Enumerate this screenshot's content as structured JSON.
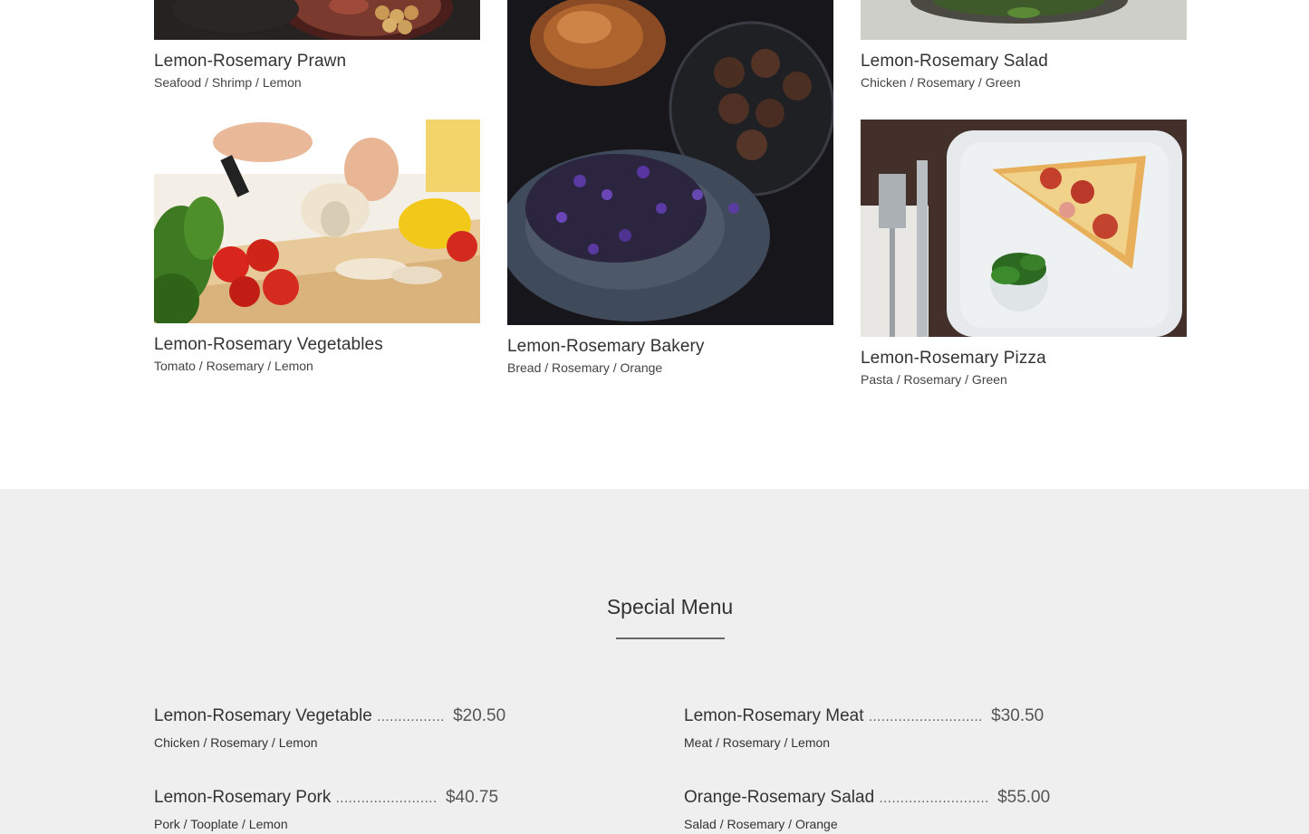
{
  "gallery": {
    "cards": [
      {
        "title": "Lemon-Rosemary Prawn",
        "tags": "Seafood / Shrimp / Lemon"
      },
      {
        "title": "Lemon-Rosemary Salad",
        "tags": "Chicken / Rosemary / Green"
      },
      {
        "title": "Lemon-Rosemary Vegetables",
        "tags": "Tomato / Rosemary / Lemon"
      },
      {
        "title": "Lemon-Rosemary Bakery",
        "tags": "Bread / Rosemary / Orange"
      },
      {
        "title": "Lemon-Rosemary Pizza",
        "tags": "Pasta / Rosemary / Green"
      }
    ]
  },
  "special_menu": {
    "title": "Special Menu",
    "items": [
      {
        "name": "Lemon-Rosemary Vegetable",
        "dots": "................",
        "price": "$20.50",
        "tags": "Chicken / Rosemary / Lemon"
      },
      {
        "name": "Lemon-Rosemary Meat",
        "dots": "...........................",
        "price": "$30.50",
        "tags": "Meat / Rosemary / Lemon"
      },
      {
        "name": "Lemon-Rosemary Pork",
        "dots": "........................",
        "price": "$40.75",
        "tags": "Pork / Tooplate / Lemon"
      },
      {
        "name": "Orange-Rosemary Salad",
        "dots": "..........................",
        "price": "$55.00",
        "tags": "Salad / Rosemary / Orange"
      }
    ]
  },
  "colors": {
    "section_bg": "#efefef",
    "text": "#333333",
    "rule": "#666666"
  }
}
